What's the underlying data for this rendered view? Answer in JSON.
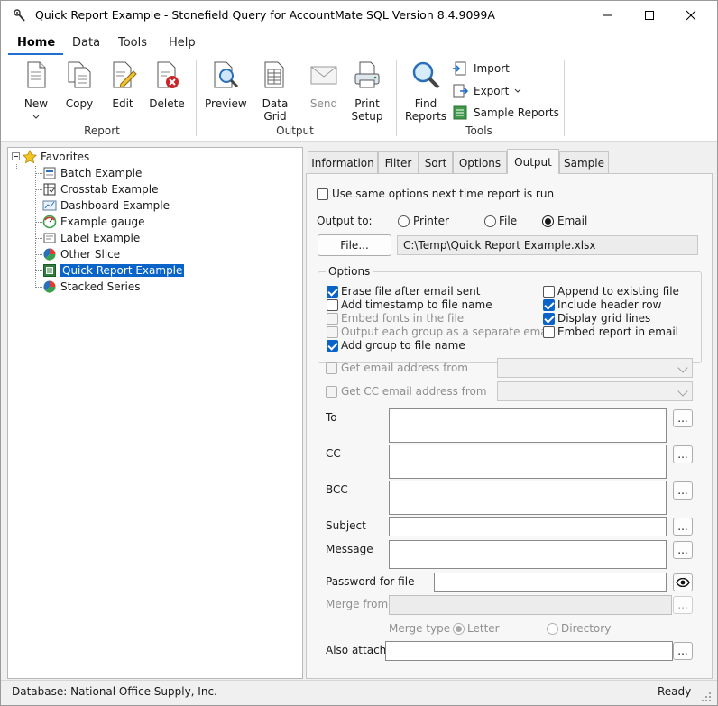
{
  "window": {
    "title": "Quick Report Example - Stonefield Query for AccountMate SQL Version 8.4.9099A"
  },
  "menu": {
    "items": [
      "Home",
      "Data",
      "Tools",
      "Help"
    ]
  },
  "ribbon": {
    "report": {
      "new": "New",
      "copy": "Copy",
      "edit": "Edit",
      "delete": "Delete",
      "label": "Report"
    },
    "output": {
      "preview": "Preview",
      "datagrid": "Data Grid",
      "send": "Send",
      "print1": "Print",
      "print2": "Setup",
      "label": "Output"
    },
    "tools": {
      "find1": "Find",
      "find2": "Reports",
      "import": "Import",
      "export": "Export",
      "sample": "Sample Reports",
      "label": "Tools"
    }
  },
  "tree": {
    "root": "Favorites",
    "items": [
      "Batch Example",
      "Crosstab Example",
      "Dashboard Example",
      "Example gauge",
      "Label Example",
      "Other Slice",
      "Quick Report Example",
      "Stacked Series"
    ],
    "selected": "Quick Report Example"
  },
  "tabs": [
    "Information",
    "Filter",
    "Sort",
    "Options",
    "Output",
    "Sample"
  ],
  "active_tab": "Output",
  "output": {
    "same_options": "Use same options next time report is run",
    "output_to": "Output to:",
    "printer": "Printer",
    "file": "File",
    "email": "Email",
    "selected_output": "Email",
    "file_button": "File...",
    "file_path": "C:\\Temp\\Quick Report Example.xlsx",
    "options_legend": "Options",
    "options": {
      "erase": {
        "label": "Erase file after email sent",
        "checked": true
      },
      "timestamp": {
        "label": "Add timestamp to file name",
        "checked": false
      },
      "embed_fonts": {
        "label": "Embed fonts in the file",
        "checked": false
      },
      "each_group": {
        "label": "Output each group as a separate email",
        "checked": false
      },
      "add_group": {
        "label": "Add group to file name",
        "checked": true
      },
      "append": {
        "label": "Append to existing file",
        "checked": false
      },
      "header_row": {
        "label": "Include header row",
        "checked": true
      },
      "grid_lines": {
        "label": "Display grid lines",
        "checked": true
      },
      "embed_email": {
        "label": "Embed report in email",
        "checked": false
      }
    },
    "get_email": "Get email address from",
    "get_cc": "Get CC email address from",
    "to": "To",
    "cc": "CC",
    "bcc": "BCC",
    "subject": "Subject",
    "message": "Message",
    "password": "Password for file",
    "merge_from": "Merge from",
    "merge_type": "Merge type",
    "letter": "Letter",
    "directory": "Directory",
    "also_attach": "Also attach",
    "ellipsis": "..."
  },
  "status": {
    "database": "Database: National Office Supply, Inc.",
    "state": "Ready"
  }
}
